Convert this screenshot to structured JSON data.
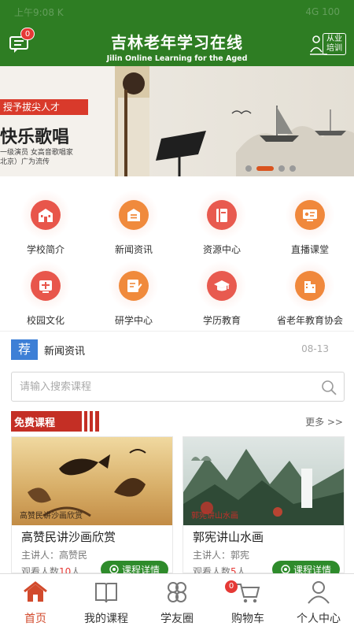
{
  "status_bar": {
    "left": "上午9:08 K",
    "right": "4G 100"
  },
  "header": {
    "message_badge": "0",
    "title_cn": "吉林老年学习在线",
    "title_en": "Jilin Online Learning for the Aged",
    "vocational_label": "从业培训"
  },
  "banner": {
    "tag": "授予拔尖人才",
    "title": "快乐歌唱",
    "subtitle_line1": "一级演员 女高音歌唱家",
    "subtitle_line2": "北京）广为流传",
    "active_slide": 2,
    "slide_count": 4
  },
  "entries": [
    {
      "label": "学校简介",
      "icon": "school-icon",
      "color": "#e8564b"
    },
    {
      "label": "新闻资讯",
      "icon": "news-icon",
      "color": "#f08a3c"
    },
    {
      "label": "资源中心",
      "icon": "book-icon",
      "color": "#e85a4f"
    },
    {
      "label": "直播课堂",
      "icon": "live-icon",
      "color": "#f0883c"
    },
    {
      "label": "校园文化",
      "icon": "culture-icon",
      "color": "#e8564b"
    },
    {
      "label": "研学中心",
      "icon": "study-icon",
      "color": "#f08a3c"
    },
    {
      "label": "学历教育",
      "icon": "graduation-cap-icon",
      "color": "#e85a4f"
    },
    {
      "label": "省老年教育协会",
      "icon": "building-icon",
      "color": "#f0883c"
    }
  ],
  "news": {
    "tag": "荐",
    "title": "新闻资讯",
    "date": "08-13"
  },
  "search": {
    "placeholder": "请输入搜索课程",
    "value": ""
  },
  "free_courses": {
    "title": "免费课程",
    "more": "更多 >>"
  },
  "courses": [
    {
      "title": "高赞民讲沙画欣赏",
      "speaker_label": "主讲人：",
      "speaker": "高赞民",
      "viewers_label": "观看人数",
      "viewers": "10",
      "viewers_unit": "人",
      "detail_label": "课程详情",
      "thumb_caption": "高赞民讲沙画欣赏"
    },
    {
      "title": "郭宪讲山水画",
      "speaker_label": "主讲人：",
      "speaker": "郭宪",
      "viewers_label": "观看人数",
      "viewers": "5",
      "viewers_unit": "人",
      "detail_label": "课程详情",
      "thumb_caption": "郭宪讲山水画"
    }
  ],
  "tabs": [
    {
      "label": "首页",
      "icon": "home-icon",
      "active": true
    },
    {
      "label": "我的课程",
      "icon": "course-book-icon",
      "active": false
    },
    {
      "label": "学友圈",
      "icon": "circle-friends-icon",
      "active": false
    },
    {
      "label": "购物车",
      "icon": "cart-icon",
      "active": false,
      "badge": "0"
    },
    {
      "label": "个人中心",
      "icon": "user-icon",
      "active": false
    }
  ],
  "colors": {
    "header_green": "#2e7d23",
    "accent_red": "#c42f25",
    "button_green": "#2e8b2b",
    "tag_blue": "#3d7fd6"
  }
}
